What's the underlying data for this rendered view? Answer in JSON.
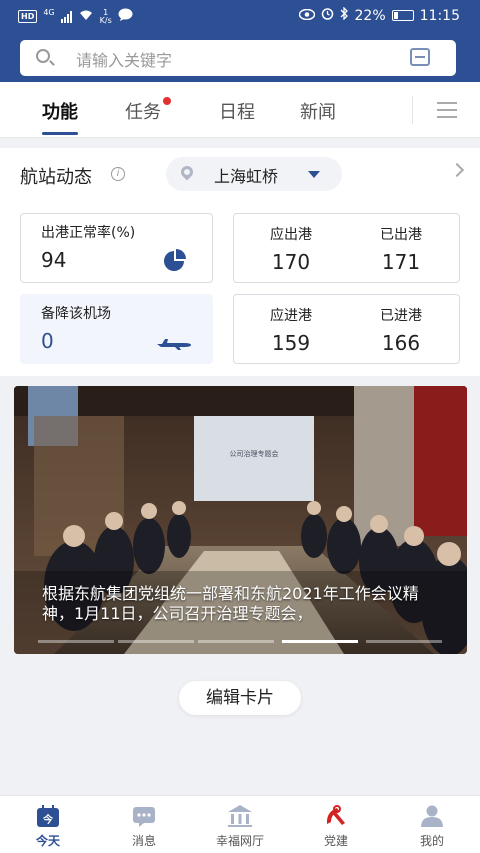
{
  "status_bar": {
    "network": "HD",
    "net_gen": "4G",
    "speed_value": "1",
    "speed_unit": "K/s",
    "battery": "22%",
    "time": "11:15"
  },
  "search": {
    "placeholder": "请输入关键字",
    "icon": "search-icon",
    "scan_icon": "scan-icon"
  },
  "tabs": [
    {
      "label": "功能",
      "active": true
    },
    {
      "label": "任务",
      "badge": true
    },
    {
      "label": "日程"
    },
    {
      "label": "新闻"
    }
  ],
  "station": {
    "title": "航站动态",
    "airport": "上海虹桥",
    "stats": {
      "outbound_rate_label": "出港正常率(%)",
      "outbound_rate_value": "94",
      "alternate_label": "备降该机场",
      "alternate_value": "0",
      "planned_departures_label": "应出港",
      "planned_departures_value": "170",
      "actual_departures_label": "已出港",
      "actual_departures_value": "171",
      "planned_arrivals_label": "应进港",
      "planned_arrivals_value": "159",
      "actual_arrivals_label": "已进港",
      "actual_arrivals_value": "166"
    }
  },
  "banner": {
    "screen_text": "公司治理专题会",
    "caption": "根据东航集团党组统一部署和东航2021年工作会议精神，1月11日，公司召开治理专题会，",
    "indicator_count": 5,
    "active_index": 3
  },
  "edit_button": "编辑卡片",
  "bottom_nav": [
    {
      "label": "今天",
      "icon": "calendar-today-icon",
      "icon_text": "今",
      "active": true
    },
    {
      "label": "消息",
      "icon": "message-icon"
    },
    {
      "label": "幸福网厅",
      "icon": "hall-icon"
    },
    {
      "label": "党建",
      "icon": "party-emblem-icon"
    },
    {
      "label": "我的",
      "icon": "profile-icon"
    }
  ],
  "colors": {
    "brand": "#2d4f93",
    "badge": "#e23030",
    "party": "#d42323"
  }
}
